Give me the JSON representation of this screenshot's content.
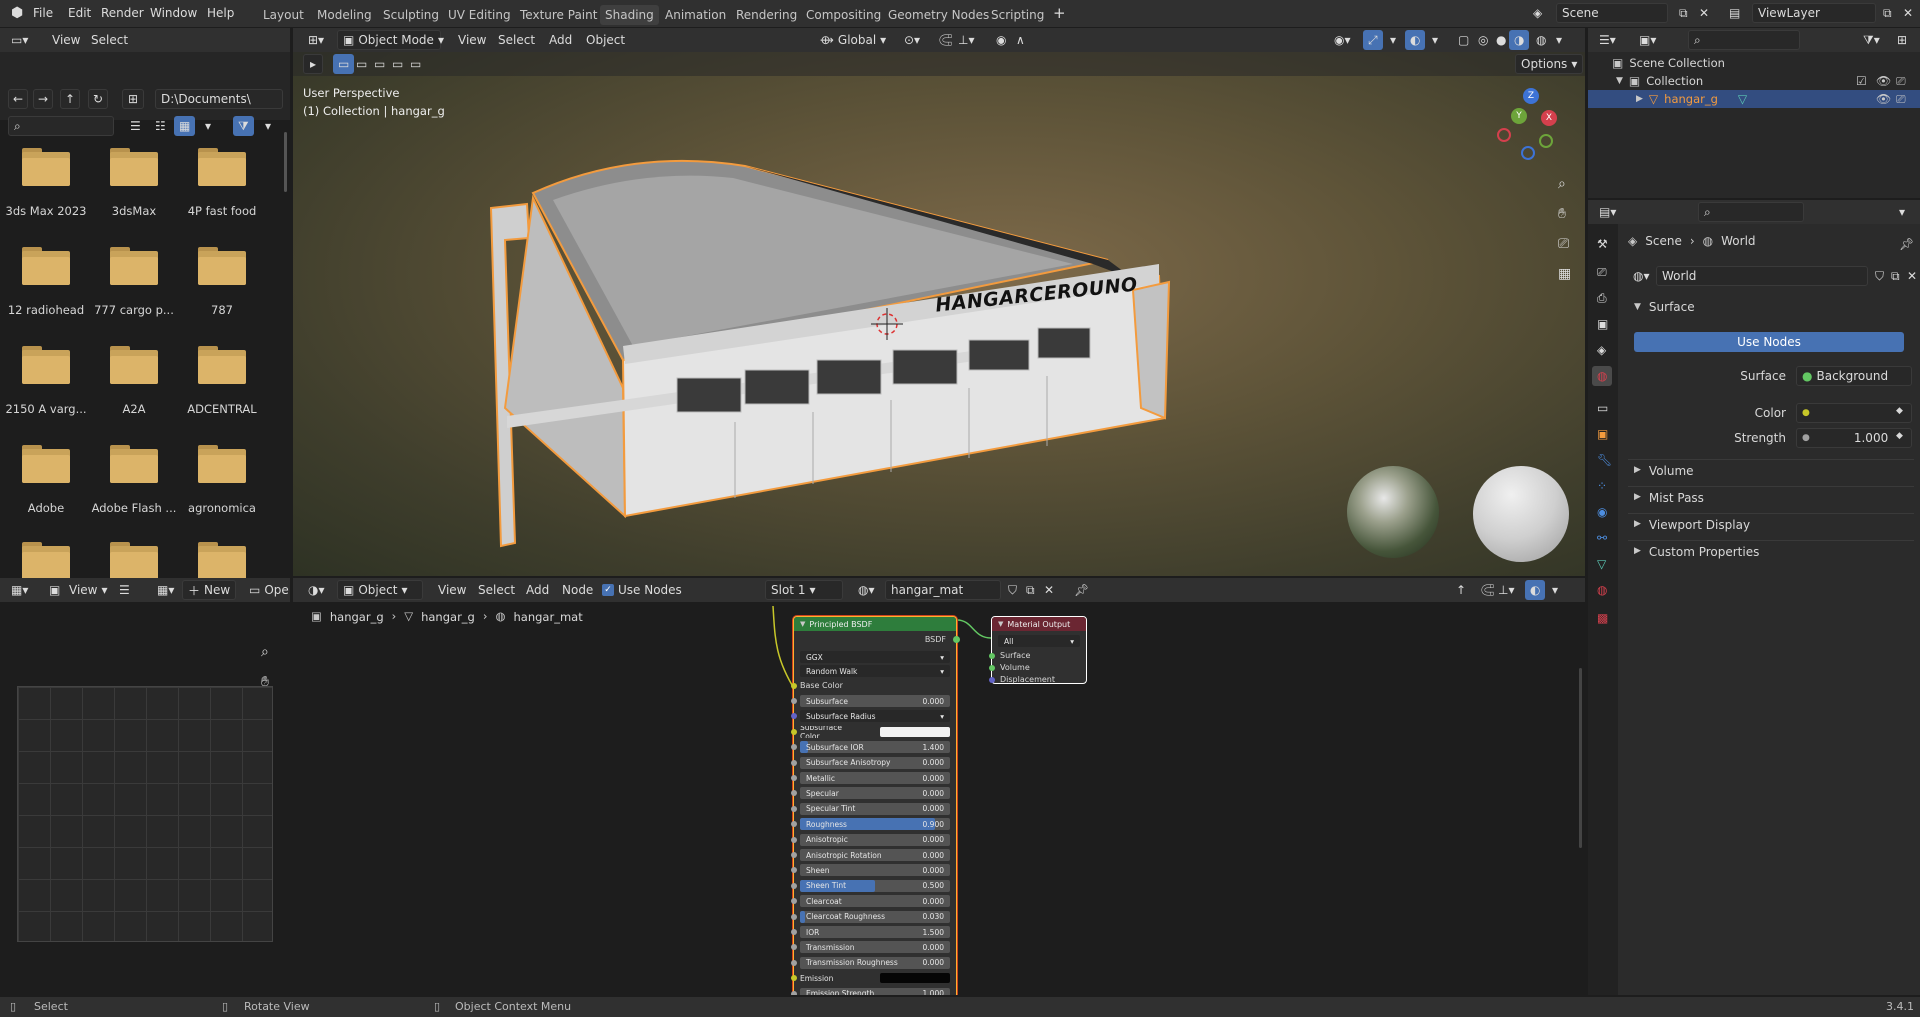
{
  "menu": {
    "file": "File",
    "edit": "Edit",
    "render": "Render",
    "window": "Window",
    "help": "Help"
  },
  "workspaces": [
    "Layout",
    "Modeling",
    "Sculpting",
    "UV Editing",
    "Texture Paint",
    "Shading",
    "Animation",
    "Rendering",
    "Compositing",
    "Geometry Nodes",
    "Scripting"
  ],
  "scene": {
    "name": "Scene",
    "view_layer": "ViewLayer"
  },
  "file_browser": {
    "view": "View",
    "select": "Select",
    "path": "D:\\Documents\\",
    "folders": [
      "3ds Max 2023",
      "3dsMax",
      "4P fast food",
      "12 radiohead",
      "777 cargo p...",
      "787",
      "2150 A varg...",
      "A2A",
      "ADCENTRAL",
      "Adobe",
      "Adobe Flash ...",
      "agronomica"
    ]
  },
  "viewport": {
    "mode": "Object Mode",
    "view": "View",
    "select": "Select",
    "add": "Add",
    "object": "Object",
    "orientation": "Global",
    "options": "Options",
    "perspective": "User Perspective",
    "collection_label": "(1) Collection | hangar_g",
    "hangar_text": "HANGARCEROUNO"
  },
  "gizmo": {
    "z": "Z",
    "y": "Y",
    "x": "X"
  },
  "outliner": {
    "scene_collection": "Scene Collection",
    "collection": "Collection",
    "object": "hangar_g"
  },
  "properties": {
    "breadcrumb_scene": "Scene",
    "breadcrumb_world": "World",
    "world_name": "World",
    "surface_panel": "Surface",
    "use_nodes": "Use Nodes",
    "surface_label": "Surface",
    "surface_value": "Background",
    "color_label": "Color",
    "strength_label": "Strength",
    "strength_value": "1.000",
    "panels": [
      "Volume",
      "Mist Pass",
      "Viewport Display",
      "Custom Properties"
    ]
  },
  "image_editor": {
    "view": "View",
    "new": "New",
    "open": "Ope"
  },
  "node_editor": {
    "object_mode": "Object",
    "view": "View",
    "select": "Select",
    "add": "Add",
    "node": "Node",
    "use_nodes": "Use Nodes",
    "slot": "Slot 1",
    "material": "hangar_mat",
    "breadcrumb": [
      "hangar_g",
      "hangar_g",
      "hangar_mat"
    ]
  },
  "bsdf": {
    "title": "Principled BSDF",
    "output_label": "BSDF",
    "distribution": "GGX",
    "subsurface_method": "Random Walk",
    "base_color": "Base Color",
    "rows": [
      {
        "label": "Subsurface",
        "value": "0.000",
        "fill": 0
      },
      {
        "label": "Subsurface Radius",
        "value": "",
        "fill": 0,
        "dropdown": true
      },
      {
        "label": "Subsurface Color",
        "value": "",
        "fill": 0,
        "color": "#f2f2f2"
      },
      {
        "label": "Subsurface IOR",
        "value": "1.400",
        "fill": 0.05
      },
      {
        "label": "Subsurface Anisotropy",
        "value": "0.000",
        "fill": 0
      },
      {
        "label": "Metallic",
        "value": "0.000",
        "fill": 0
      },
      {
        "label": "Specular",
        "value": "0.000",
        "fill": 0
      },
      {
        "label": "Specular Tint",
        "value": "0.000",
        "fill": 0
      },
      {
        "label": "Roughness",
        "value": "0.900",
        "fill": 0.9
      },
      {
        "label": "Anisotropic",
        "value": "0.000",
        "fill": 0
      },
      {
        "label": "Anisotropic Rotation",
        "value": "0.000",
        "fill": 0
      },
      {
        "label": "Sheen",
        "value": "0.000",
        "fill": 0
      },
      {
        "label": "Sheen Tint",
        "value": "0.500",
        "fill": 0.5
      },
      {
        "label": "Clearcoat",
        "value": "0.000",
        "fill": 0
      },
      {
        "label": "Clearcoat Roughness",
        "value": "0.030",
        "fill": 0.03
      },
      {
        "label": "IOR",
        "value": "1.500",
        "fill": 0
      },
      {
        "label": "Transmission",
        "value": "0.000",
        "fill": 0
      },
      {
        "label": "Transmission Roughness",
        "value": "0.000",
        "fill": 0
      },
      {
        "label": "Emission",
        "value": "",
        "fill": 0,
        "color": "#050505"
      },
      {
        "label": "Emission Strength",
        "value": "1.000",
        "fill": 0
      }
    ]
  },
  "output_node": {
    "title": "Material Output",
    "target": "All",
    "surface": "Surface",
    "volume": "Volume",
    "displacement": "Displacement"
  },
  "status": {
    "select": "Select",
    "rotate": "Rotate View",
    "context": "Object Context Menu",
    "version": "3.4.1"
  },
  "colors": {
    "accent": "#4772b3",
    "selection": "#f39b3e",
    "folder": "#dcb469"
  }
}
